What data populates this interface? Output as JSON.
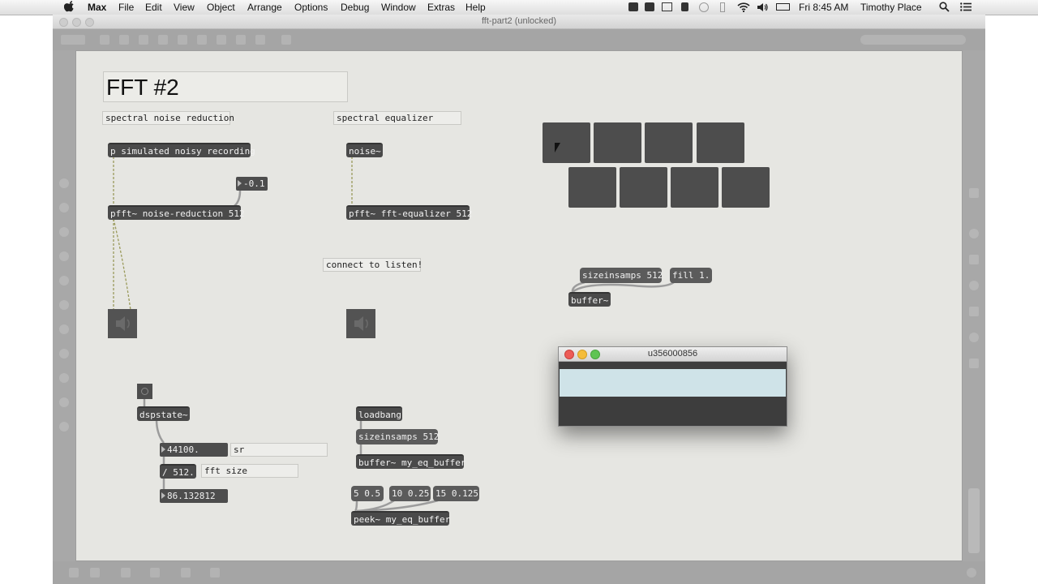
{
  "menubar": {
    "app": "Max",
    "items": [
      "File",
      "Edit",
      "View",
      "Object",
      "Arrange",
      "Options",
      "Debug",
      "Window",
      "Extras",
      "Help"
    ],
    "clock": "Fri 8:45 AM",
    "user": "Timothy Place"
  },
  "window": {
    "title": "fft-part2 (unlocked)"
  },
  "patch": {
    "title": "FFT #2",
    "comments": {
      "spectral_noise_reduction": "spectral noise reduction",
      "spectral_equalizer": "spectral equalizer",
      "sr": "sr",
      "fft_size": "fft size"
    },
    "objects": {
      "p_simulated": "p simulated noisy recording",
      "pfft_noise": "pfft~ noise-reduction 512",
      "noise": "noise~",
      "pfft_eq": "pfft~ fft-equalizer 512",
      "buffer": "buffer~",
      "dspstate": "dspstate~",
      "divide": "/ 512.",
      "loadbang": "loadbang",
      "buffer_eq": "buffer~ my_eq_buffer",
      "peek_eq": "peek~ my_eq_buffer"
    },
    "messages": {
      "connect_to_listen": "connect to listen!",
      "sizeinsamps_top": "sizeinsamps 512",
      "fill": "fill 1.",
      "sizeinsamps_bottom": "sizeinsamps 512",
      "msg_5": "5 0.5",
      "msg_10": "10 0.25",
      "msg_15": "15 0.125"
    },
    "numbers": {
      "gain": "-0.1",
      "sr_value": "44100.",
      "bin_hz": "86.132812"
    }
  },
  "buffer_window": {
    "title": "u356000856"
  }
}
